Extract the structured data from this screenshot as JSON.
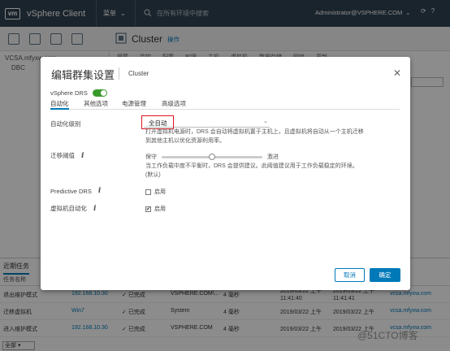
{
  "topbar": {
    "logo": "vm",
    "app_title": "vSphere Client",
    "menu_label": "菜单",
    "search_placeholder": "在所有环境中搜索",
    "user": "Administrator@VSPHERE.COM"
  },
  "navbar": {
    "cluster_title": "Cluster",
    "actions_label": "操作"
  },
  "tree": {
    "root": "VCSA.mfyxw.com",
    "dc": "DBC"
  },
  "background_tabs": [
    "摘要",
    "监控",
    "配置",
    "权限",
    "主机",
    "虚拟机",
    "数据存储",
    "网络",
    "更新"
  ],
  "tasks": {
    "tab_label": "近期任务",
    "header_col1": "任务名称",
    "rows": [
      {
        "name": "退出维护模式",
        "target": "192.168.10.30",
        "status": "已完成",
        "initiator": "VSPHERE.COM\\...",
        "queued": "4 毫秒",
        "start": "2019/03/22 上午 11:41:40",
        "end": "2019/03/22 上午 11:41:41",
        "server": "vcsa.mfyxw.com"
      },
      {
        "name": "迁移虚拟机",
        "target": "Win7",
        "status": "已完成",
        "initiator": "System",
        "queued": "4 毫秒",
        "start": "2019/03/22 上午",
        "end": "2019/03/22 上午",
        "server": "vcsa.mfyxw.com"
      },
      {
        "name": "进入维护模式",
        "target": "192.168.10.30",
        "status": "已完成",
        "initiator": "VSPHERE.COM",
        "queued": "4 毫秒",
        "start": "2019/03/22 上午",
        "end": "2019/03/22 上午",
        "server": "vcsa.mfyxw.com"
      }
    ],
    "filter": "全部",
    "watermark": "@51CTO博客"
  },
  "dialog": {
    "title": "编辑群集设置",
    "subtitle": "Cluster",
    "drs_label": "vSphere DRS",
    "tabs": [
      "自动化",
      "其他选项",
      "电源管理",
      "高级选项"
    ],
    "automation_label": "自动化级别",
    "automation_value": "全自动",
    "automation_desc_1": "打开虚拟机电源时，DRS 会自动将虚拟机置于主机上，且虚拟机将自动从一个主机迁移",
    "automation_desc_2": "到其他主机以优化资源利用率。",
    "threshold_label": "迁移阈值",
    "slider_left": "保守",
    "slider_right": "激进",
    "slider_level": 0.5,
    "threshold_desc_1": "当工作负载中度不平衡时，DRS 会提供建议。此阈值建议用于工作负载稳定的环境。",
    "threshold_desc_2": "(默认)",
    "predictive_label": "Predictive DRS",
    "predictive_check": "启用",
    "vm_auto_label": "虚拟机自动化",
    "vm_auto_check": "启用",
    "cancel_label": "取消",
    "ok_label": "确定"
  }
}
